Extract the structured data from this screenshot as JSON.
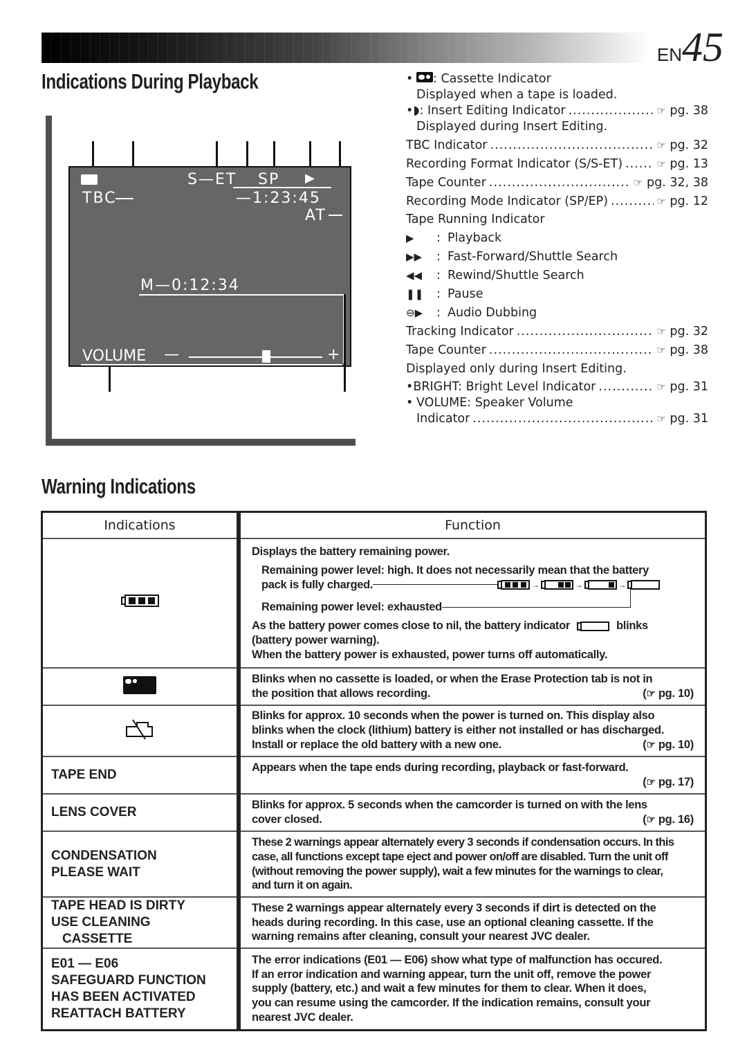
{
  "page": {
    "lang": "EN",
    "number": "45"
  },
  "section1": {
    "title": "Indications During Playback",
    "osd": {
      "tbc": "TBC",
      "format": "S—ET",
      "mode": "SP",
      "counter": "—1:23:45",
      "at": "AT",
      "memory": "M—0:12:34",
      "volume_label": "VOLUME",
      "volume_minus": "—",
      "volume_plus": "+",
      "volume_level": 0.58
    },
    "indicators": [
      {
        "bullet": "•",
        "icon": "cassette-icon",
        "label": ": Cassette Indicator",
        "ref": ""
      },
      {
        "sub": true,
        "label": "Displayed when a tape is loaded.",
        "ref": ""
      },
      {
        "bullet": "•",
        "icon": "insert-edit-icon",
        "label": "◗: Insert Editing Indicator",
        "ref": "pg. 38"
      },
      {
        "sub": true,
        "label": "Displayed during Insert Editing.",
        "ref": ""
      },
      {
        "label": "TBC Indicator",
        "ref": "pg. 32"
      },
      {
        "label": "Recording Format Indicator (S/S-ET)",
        "ref": "pg. 13"
      },
      {
        "label": "Tape Counter",
        "ref": "pg. 32, 38"
      },
      {
        "label": "Recording Mode Indicator (SP/EP)",
        "ref": "pg. 12"
      },
      {
        "label": "Tape Running Indicator",
        "ref": ""
      }
    ],
    "tape_running": [
      {
        "symbol": "▶",
        "label": "Playback"
      },
      {
        "symbol": "▶▶",
        "label": "Fast-Forward/Shuttle Search"
      },
      {
        "symbol": "◀◀",
        "label": "Rewind/Shuttle Search"
      },
      {
        "symbol": "❚❚",
        "label": "Pause"
      },
      {
        "symbol": "⊖▶",
        "label": "Audio Dubbing"
      }
    ],
    "indicators2": [
      {
        "label": "Tracking Indicator",
        "ref": "pg. 32"
      },
      {
        "label": "Tape Counter",
        "ref": "pg. 38"
      },
      {
        "label": "Displayed only during Insert Editing.",
        "ref": ""
      },
      {
        "bullet": "•",
        "label": "BRIGHT: Bright Level Indicator",
        "ref": "pg. 31"
      },
      {
        "bullet": "•",
        "label": "VOLUME: Speaker Volume",
        "ref": ""
      },
      {
        "sub": true,
        "label": "Indicator",
        "ref": "pg. 31"
      }
    ],
    "hand_symbol": "☞",
    "colon": ":"
  },
  "section2": {
    "title": "Warning Indications",
    "headers": {
      "indications": "Indications",
      "function": "Function"
    },
    "rows": [
      {
        "icon": "battery-full-icon",
        "lines": [
          "Displays the battery remaining power.",
          "Remaining power level: high. It does not necessarily mean that the battery",
          "pack is fully charged.",
          "Remaining power level: exhausted",
          "As the battery power comes close to nil, the battery indicator",
          "blinks",
          "(battery power warning).",
          "When the battery power is exhausted, power turns off automatically."
        ]
      },
      {
        "icon": "cassette-icon",
        "lines": [
          "Blinks when no cassette is loaded, or when the Erase Protection tab is not in",
          "the position that allows recording."
        ],
        "ref": "pg. 10"
      },
      {
        "icon": "clock-battery-icon",
        "lines": [
          "Blinks for approx. 10 seconds when the power is turned on. This display also",
          "blinks when the clock (lithium) battery is either not installed or has discharged.",
          "Install or replace the old battery with a new one."
        ],
        "ref": "pg. 10"
      },
      {
        "label": [
          "TAPE END"
        ],
        "lines": [
          "Appears when the tape ends during recording, playback or fast-forward."
        ],
        "ref": "pg. 17"
      },
      {
        "label": [
          "LENS COVER"
        ],
        "lines": [
          "Blinks for approx. 5 seconds when the camcorder is turned on with the lens",
          "cover closed."
        ],
        "ref": "pg. 16"
      },
      {
        "label": [
          "CONDENSATION",
          "PLEASE WAIT"
        ],
        "lines": [
          "These 2 warnings appear alternately every 3 seconds if condensation occurs. In this",
          "case, all functions except tape eject and power on/off are disabled. Turn the unit off",
          "(without removing the power supply), wait a few minutes for the warnings to clear,",
          "and turn it on again."
        ]
      },
      {
        "label": [
          "TAPE HEAD IS DIRTY",
          "USE CLEANING",
          "CASSETTE"
        ],
        "lines": [
          "These 2 warnings appear alternately every 3 seconds if dirt is detected on the",
          "heads during recording. In this case, use an optional cleaning cassette. If the",
          "warning remains after cleaning, consult your nearest JVC dealer."
        ]
      },
      {
        "label": [
          "E01 — E06",
          "SAFEGUARD FUNCTION",
          "HAS BEEN ACTIVATED",
          "REATTACH BATTERY"
        ],
        "lines": [
          "The error indications (E01 — E06) show what type of malfunction has occured.",
          "If an error indication and warning appear, turn the unit off, remove the power",
          "supply (battery, etc.) and wait a few minutes for them to clear. When it does,",
          "you can resume using the camcorder. If the indication remains, consult your",
          "nearest JVC dealer."
        ]
      }
    ]
  }
}
